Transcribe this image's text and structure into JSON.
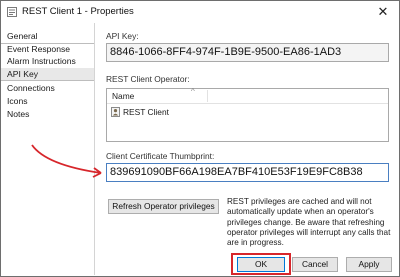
{
  "window": {
    "title": "REST Client 1 - Properties",
    "close_glyph": "✕"
  },
  "sidebar": {
    "items": [
      {
        "label": "General"
      },
      {
        "label": "Event Response"
      },
      {
        "label": "Alarm Instructions"
      },
      {
        "label": "API Key"
      },
      {
        "label": "Connections"
      },
      {
        "label": "Icons"
      },
      {
        "label": "Notes"
      }
    ]
  },
  "main": {
    "api_key_label": "API Key:",
    "api_key_value": "8846-1066-8FF4-974F-1B9E-9500-EA86-1AD3",
    "operator_label": "REST Client Operator:",
    "operator_list": {
      "column_header": "Name",
      "sort_caret": "^",
      "rows": [
        {
          "name": "REST Client"
        }
      ]
    },
    "thumbprint_label": "Client Certificate Thumbprint:",
    "thumbprint_value": "839691090BF66A198EA7BF410E53F19E9FC8B38",
    "refresh_button": "Refresh Operator privileges",
    "info_text": "REST privileges are cached and will not automatically update when an operator's privileges change. Be aware that refreshing operator privileges will interrupt any calls that are in progress."
  },
  "footer": {
    "ok": "OK",
    "cancel": "Cancel",
    "apply": "Apply"
  },
  "colors": {
    "annotation_red": "#d7262b",
    "accent_blue": "#4a7fc1"
  },
  "icons": {
    "title": "properties-window-icon",
    "operator": "operator-person-icon",
    "annotation": "red-curved-arrow"
  }
}
